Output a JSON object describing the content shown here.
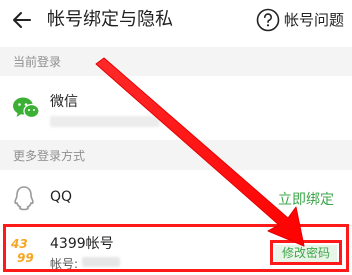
{
  "header": {
    "title": "帐号绑定与隐私",
    "help_label": "帐号问题"
  },
  "sections": {
    "current_login": "当前登录",
    "more_login": "更多登录方式"
  },
  "wechat": {
    "name": "微信",
    "icon": "wechat-icon"
  },
  "qq": {
    "name": "QQ",
    "action": "立即绑定",
    "icon": "qq-icon"
  },
  "account_4399": {
    "name": "4399帐号",
    "account_label": "帐号:",
    "action": "修改密码",
    "logo_text": "4399",
    "icon": "4399-logo"
  },
  "colors": {
    "accent_green": "#3ea64a",
    "annotation_red": "#ff1a1a",
    "logo_orange": "#f5a623",
    "section_bg": "#f4f4f4"
  }
}
